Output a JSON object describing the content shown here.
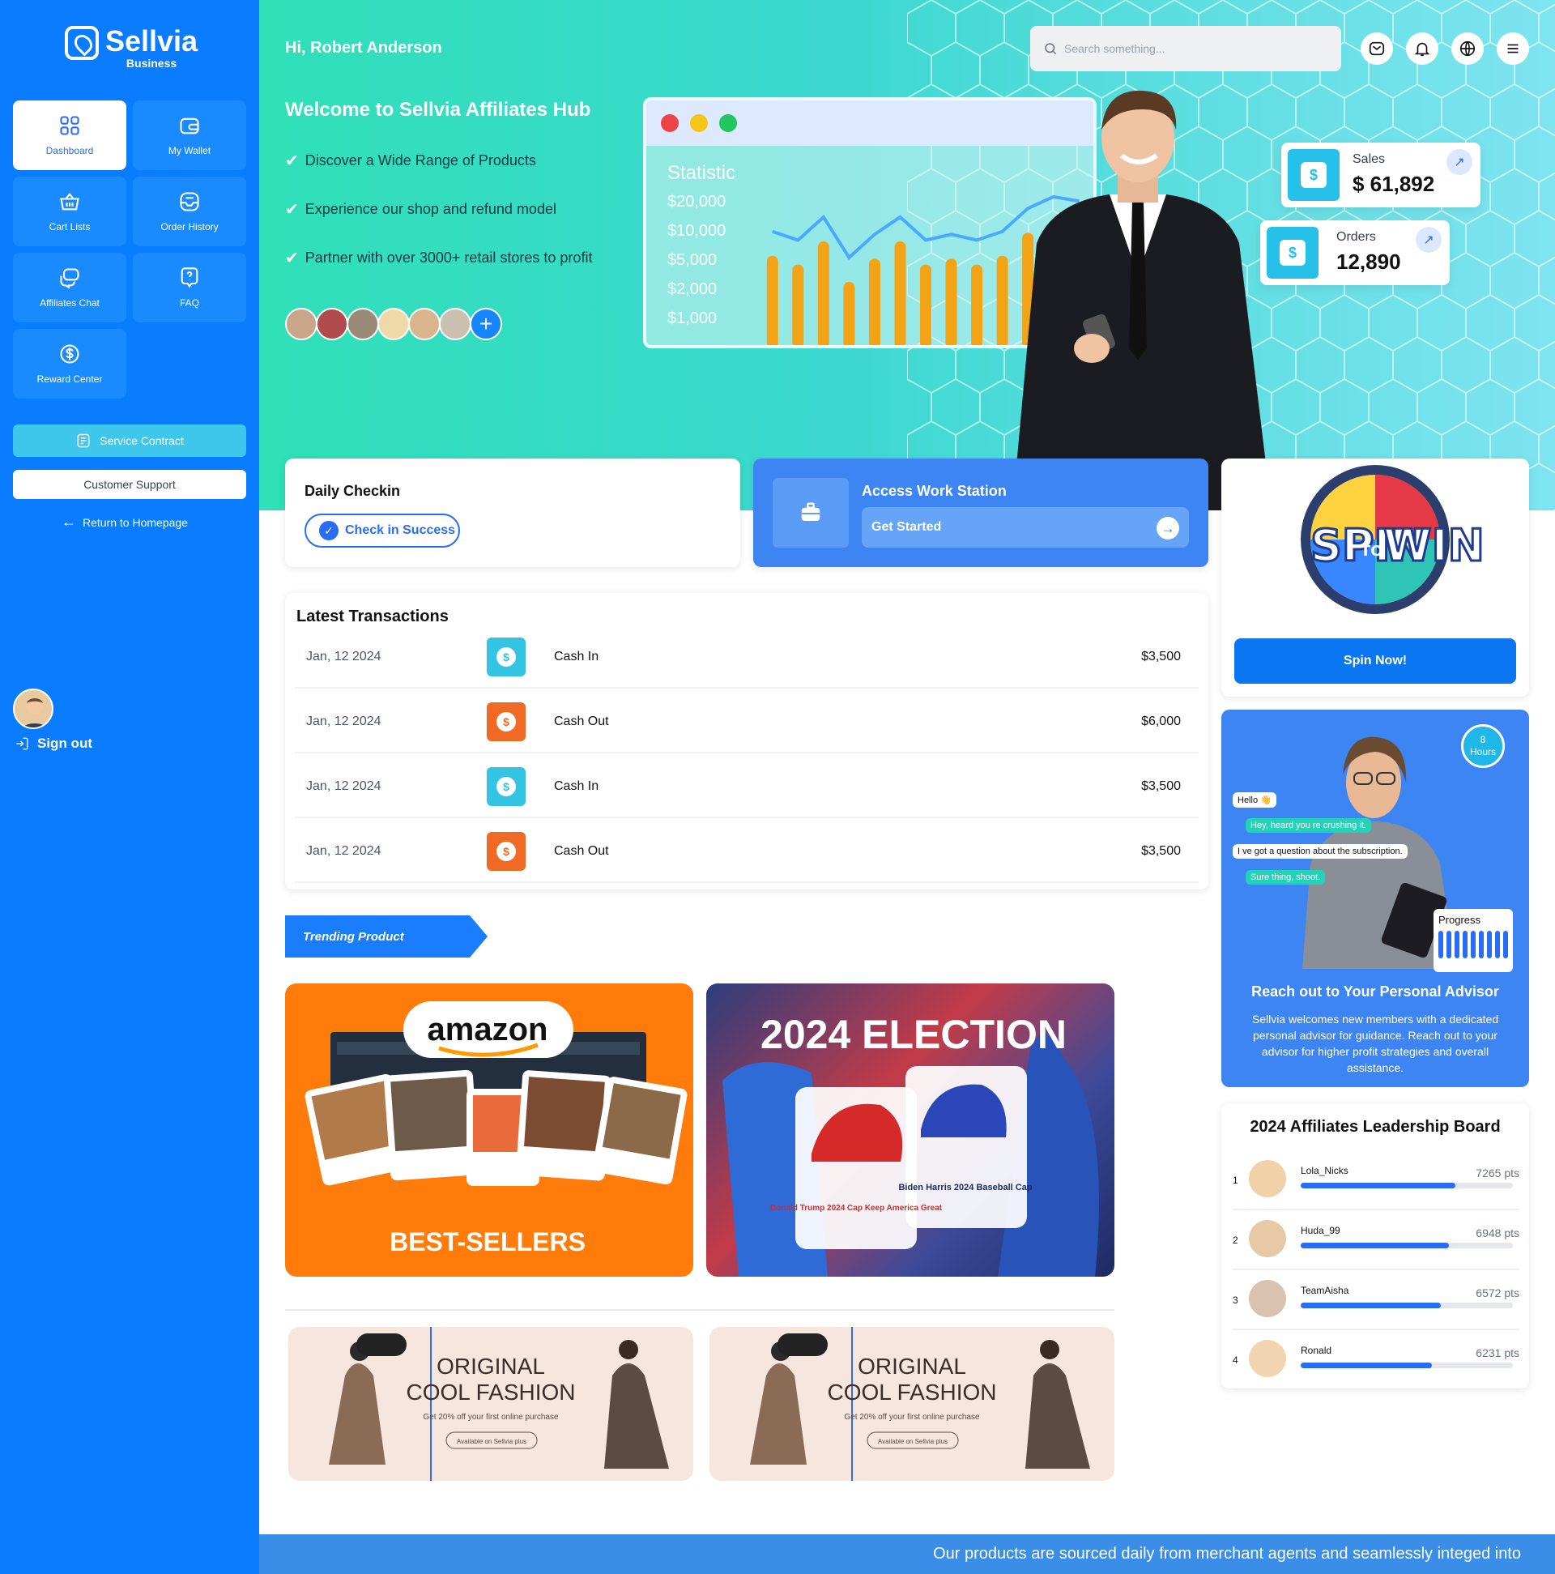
{
  "brand": {
    "name": "Sellvia",
    "sub": "Business",
    "accent": "#0a7cff"
  },
  "sidebar": {
    "items": [
      {
        "label": "Dashboard",
        "icon": "grid-icon",
        "active": true
      },
      {
        "label": "My Wallet",
        "icon": "wallet-icon",
        "active": false
      },
      {
        "label": "Cart Lists",
        "icon": "basket-icon",
        "active": false
      },
      {
        "label": "Order History",
        "icon": "inbox-icon",
        "active": false
      },
      {
        "label": "Affiliates Chat",
        "icon": "chat-icon",
        "active": false
      },
      {
        "label": "FAQ",
        "icon": "question-icon",
        "active": false
      },
      {
        "label": "Reward Center",
        "icon": "dollar-icon",
        "active": false
      }
    ],
    "service_contract": "Service Contract",
    "customer_support": "Customer Support",
    "return_home": "Return to Homepage",
    "sign_out": "Sign out"
  },
  "header": {
    "greeting": "Hi, Robert Anderson",
    "search_placeholder": "Search something..."
  },
  "hero": {
    "title": "Welcome to Sellvia Affiliates Hub",
    "features": [
      "Discover a Wide Range of Products",
      "Experience our shop and refund model",
      "Partner with over 3000+ retail stores to profit"
    ],
    "statistic": {
      "title": "Statistic",
      "y_labels": [
        "$20,000",
        "$10,000",
        "$5,000",
        "$2,000",
        "$1,000"
      ],
      "bars": [
        0.64,
        0.58,
        0.74,
        0.46,
        0.62,
        0.74,
        0.58,
        0.62,
        0.58,
        0.64,
        0.8,
        0.88,
        0.85
      ]
    },
    "sales": {
      "label": "Sales",
      "value": "$ 61,892"
    },
    "orders": {
      "label": "Orders",
      "value": "12,890"
    }
  },
  "checkin": {
    "title": "Daily Checkin",
    "button": "Check in Success"
  },
  "workstation": {
    "title": "Access Work Station",
    "button": "Get Started"
  },
  "transactions": {
    "title": "Latest Transactions",
    "rows": [
      {
        "date": "Jan, 12 2024",
        "type": "Cash In",
        "amount": "$3,500",
        "color": "#34c4e3"
      },
      {
        "date": "Jan, 12 2024",
        "type": "Cash Out",
        "amount": "$6,000",
        "color": "#f06a25"
      },
      {
        "date": "Jan, 12 2024",
        "type": "Cash In",
        "amount": "$3,500",
        "color": "#34c4e3"
      },
      {
        "date": "Jan, 12 2024",
        "type": "Cash Out",
        "amount": "$3,500",
        "color": "#f06a25"
      }
    ]
  },
  "trending": {
    "label": "Trending Product"
  },
  "banners": {
    "amazon": {
      "logo": "amazon",
      "headline": "BEST-SELLERS"
    },
    "election": {
      "headline": "2024 ELECTION",
      "cap_left": "Donald Trump 2024 Cap Keep America Great",
      "cap_right": "Biden Harris 2024 Baseball Cap"
    },
    "fashion": {
      "line1": "ORIGINAL",
      "line2": "COOL FASHION",
      "sub": "Get 20% off your first online purchase",
      "cta": "Available on Sellvia plus"
    }
  },
  "spin": {
    "line1": "SPIN",
    "mid": "TO",
    "line2": "WIN",
    "button": "Spin Now!"
  },
  "advisor": {
    "hours_num": "8",
    "hours_label": "Hours",
    "chat": [
      "Hello 👋",
      "Hey, heard you re crushing it.",
      "I ve got a question about the subscription.",
      "Sure thing, shoot."
    ],
    "progress": "Progress",
    "title": "Reach out to Your Personal Advisor",
    "desc": "Sellvia welcomes new members with a dedicated personal advisor for guidance. Reach out to your advisor for higher profit strategies and overall assistance."
  },
  "leaderboard": {
    "title": "2024 Affiliates Leadership Board",
    "rows": [
      {
        "rank": "1",
        "name": "Lola_Nicks",
        "points": "7265 pts",
        "level": 0.73
      },
      {
        "rank": "2",
        "name": "Huda_99",
        "points": "6948 pts",
        "level": 0.7
      },
      {
        "rank": "3",
        "name": "TeamAisha",
        "points": "6572 pts",
        "level": 0.66
      },
      {
        "rank": "4",
        "name": "Ronald",
        "points": "6231 pts",
        "level": 0.62
      }
    ]
  },
  "footer": {
    "text": "Our products are sourced daily from merchant agents and seamlessly integed into"
  }
}
